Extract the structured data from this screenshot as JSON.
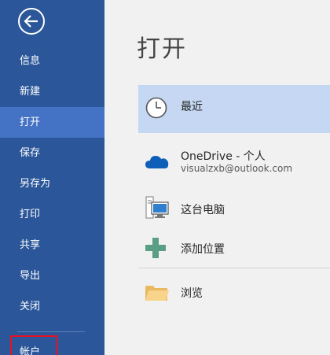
{
  "sidebar": {
    "back_icon": "back-arrow-icon",
    "items": [
      {
        "label": "信息"
      },
      {
        "label": "新建"
      },
      {
        "label": "打开"
      },
      {
        "label": "保存"
      },
      {
        "label": "另存为"
      },
      {
        "label": "打印"
      },
      {
        "label": "共享"
      },
      {
        "label": "导出"
      },
      {
        "label": "关闭"
      },
      {
        "label": "帐户"
      }
    ],
    "active_item": "打开"
  },
  "main": {
    "title": "打开",
    "locations": [
      {
        "label": "最近",
        "icon": "clock-icon",
        "selected": true
      },
      {
        "label": "OneDrive - 个人",
        "sub": "visualzxb@outlook.com",
        "icon": "onedrive-cloud-icon",
        "selected": false
      },
      {
        "label": "这台电脑",
        "icon": "computer-icon",
        "selected": false
      },
      {
        "label": "添加位置",
        "icon": "plus-icon",
        "selected": false
      },
      {
        "label": "浏览",
        "icon": "folder-icon",
        "selected": false
      }
    ]
  },
  "colors": {
    "sidebar_bg": "#2b579a",
    "sidebar_active": "#4472c4",
    "selection_bg": "#c5d7f2",
    "highlight_box": "#e81123",
    "plus_green": "#5a9e84",
    "cloud_blue": "#0f5fb8"
  }
}
